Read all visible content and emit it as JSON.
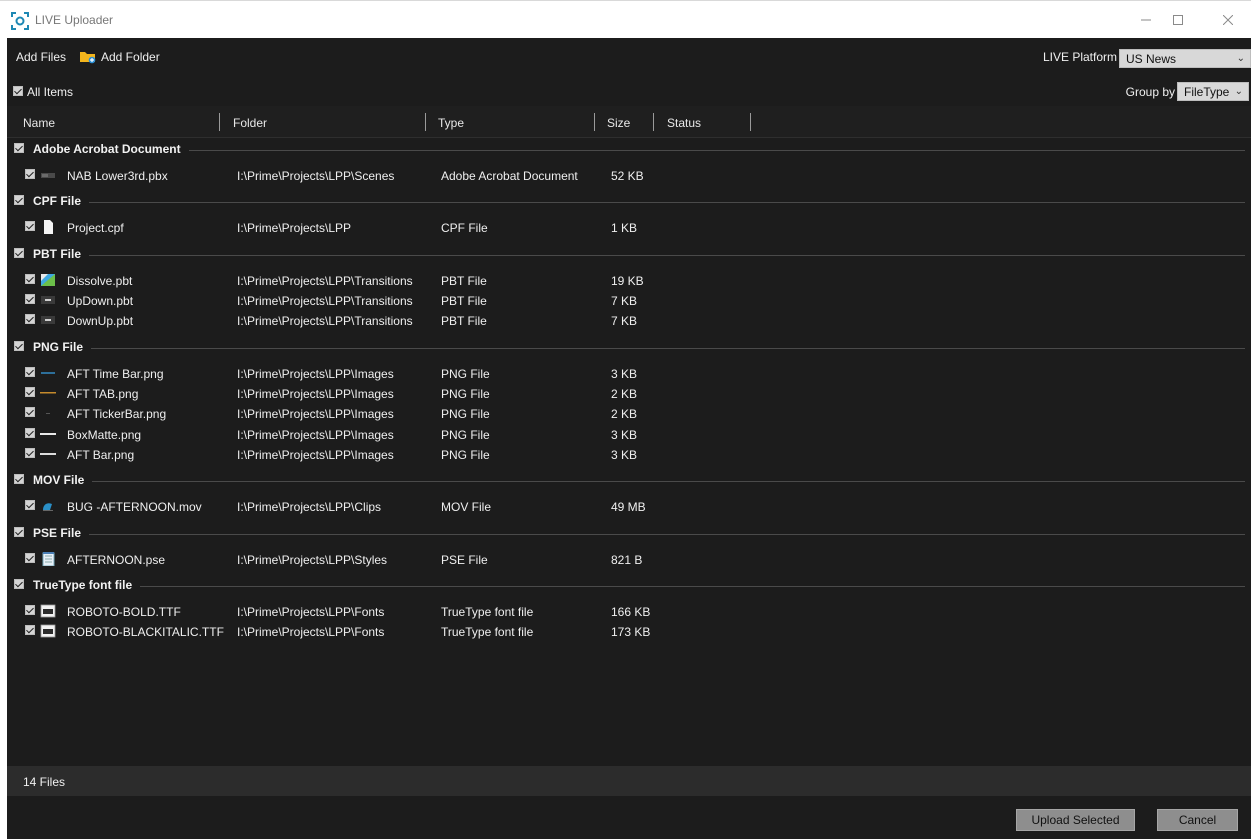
{
  "window": {
    "title": "LIVE Uploader",
    "minimize_icon": "minimize-icon",
    "maximize_icon": "maximize-icon",
    "close_icon": "close-icon"
  },
  "toolbar": {
    "add_files": "Add Files",
    "add_folder": "Add Folder",
    "platform_label": "LIVE Platform",
    "platform_value": "US News"
  },
  "subbar": {
    "all_items": "All Items",
    "group_by_label": "Group by",
    "group_by_value": "FileType"
  },
  "columns": {
    "name": "Name",
    "folder": "Folder",
    "type": "Type",
    "size": "Size",
    "status": "Status"
  },
  "groups": [
    {
      "label": "Adobe Acrobat Document",
      "files": [
        {
          "name": "NAB Lower3rd.pbx",
          "folder": "I:\\Prime\\Projects\\LPP\\Scenes",
          "type": "Adobe Acrobat Document",
          "size": "52 KB",
          "icon": "scene-thumbnail-icon"
        }
      ]
    },
    {
      "label": "CPF File",
      "files": [
        {
          "name": "Project.cpf",
          "folder": "I:\\Prime\\Projects\\LPP",
          "type": "CPF File",
          "size": "1 KB",
          "icon": "document-icon"
        }
      ]
    },
    {
      "label": "PBT File",
      "files": [
        {
          "name": "Dissolve.pbt",
          "folder": "I:\\Prime\\Projects\\LPP\\Transitions",
          "type": "PBT File",
          "size": "19 KB",
          "icon": "transition-thumbnail-icon"
        },
        {
          "name": "UpDown.pbt",
          "folder": "I:\\Prime\\Projects\\LPP\\Transitions",
          "type": "PBT File",
          "size": "7 KB",
          "icon": "transition-thumbnail-icon"
        },
        {
          "name": "DownUp.pbt",
          "folder": "I:\\Prime\\Projects\\LPP\\Transitions",
          "type": "PBT File",
          "size": "7 KB",
          "icon": "transition-thumbnail-icon"
        }
      ]
    },
    {
      "label": "PNG File",
      "files": [
        {
          "name": "AFT Time Bar.png",
          "folder": "I:\\Prime\\Projects\\LPP\\Images",
          "type": "PNG File",
          "size": "3 KB",
          "icon": "image-thumbnail-icon"
        },
        {
          "name": "AFT TAB.png",
          "folder": "I:\\Prime\\Projects\\LPP\\Images",
          "type": "PNG File",
          "size": "2 KB",
          "icon": "image-thumbnail-icon"
        },
        {
          "name": "AFT TickerBar.png",
          "folder": "I:\\Prime\\Projects\\LPP\\Images",
          "type": "PNG File",
          "size": "2 KB",
          "icon": "image-thumbnail-icon"
        },
        {
          "name": "BoxMatte.png",
          "folder": "I:\\Prime\\Projects\\LPP\\Images",
          "type": "PNG File",
          "size": "3 KB",
          "icon": "image-thumbnail-icon"
        },
        {
          "name": "AFT Bar.png",
          "folder": "I:\\Prime\\Projects\\LPP\\Images",
          "type": "PNG File",
          "size": "3 KB",
          "icon": "image-thumbnail-icon"
        }
      ]
    },
    {
      "label": "MOV File",
      "files": [
        {
          "name": "BUG -AFTERNOON.mov",
          "folder": "I:\\Prime\\Projects\\LPP\\Clips",
          "type": "MOV File",
          "size": "49 MB",
          "icon": "video-thumbnail-icon"
        }
      ]
    },
    {
      "label": "PSE File",
      "files": [
        {
          "name": "AFTERNOON.pse",
          "folder": "I:\\Prime\\Projects\\LPP\\Styles",
          "type": "PSE File",
          "size": "821 B",
          "icon": "notepad-icon"
        }
      ]
    },
    {
      "label": "TrueType font file",
      "files": [
        {
          "name": "ROBOTO-BOLD.TTF",
          "folder": "I:\\Prime\\Projects\\LPP\\Fonts",
          "type": "TrueType font file",
          "size": "166 KB",
          "icon": "font-file-icon"
        },
        {
          "name": "ROBOTO-BLACKITALIC.TTF",
          "folder": "I:\\Prime\\Projects\\LPP\\Fonts",
          "type": "TrueType font file",
          "size": "173 KB",
          "icon": "font-file-icon"
        }
      ]
    }
  ],
  "status": {
    "files_count": "14 Files"
  },
  "footer": {
    "upload_label": "Upload Selected",
    "cancel_label": "Cancel"
  },
  "colors": {
    "background": "#1c1c1c",
    "header": "#1f1f1f",
    "status_bar": "#2c2c2c",
    "button": "#8e8e8e",
    "accent": "#1e88b4"
  }
}
